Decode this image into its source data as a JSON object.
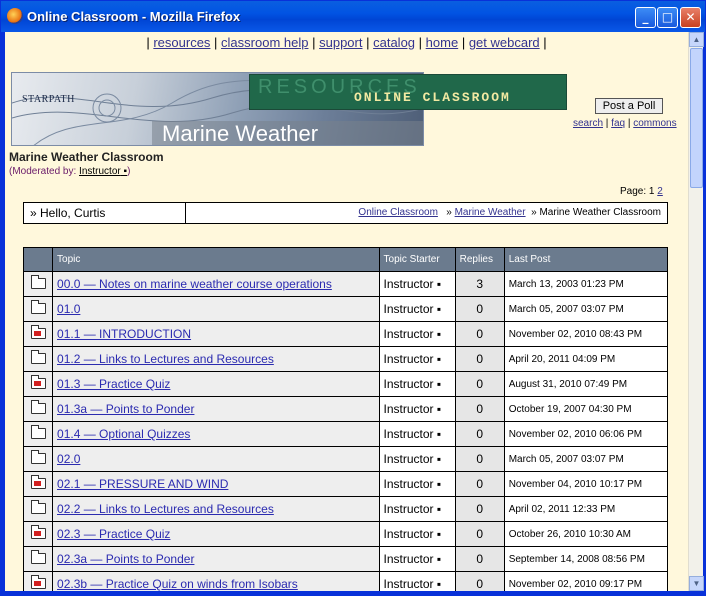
{
  "window": {
    "title": "Online Classroom - Mozilla Firefox"
  },
  "nav": {
    "links": [
      "resources",
      "classroom help",
      "support",
      "catalog",
      "home",
      "get webcard"
    ]
  },
  "banner": {
    "brand": "STARPATH",
    "resources_text": "RESOURCES",
    "online_classroom_text": "ONLINE CLASSROOM",
    "main_title": "Marine Weather"
  },
  "actions": {
    "post_poll": "Post a Poll",
    "search": "search",
    "faq": "faq",
    "commons": "commons"
  },
  "forum": {
    "title": "Marine Weather Classroom",
    "moderated_label": "(Moderated by:",
    "moderator": "Instructor",
    "page_label": "Page: 1",
    "page_next": "2"
  },
  "crumbs": {
    "hello": "Hello, Curtis",
    "online_classroom": "Online Classroom",
    "marine_weather": "Marine Weather",
    "current": "Marine Weather Classroom"
  },
  "table": {
    "headers": {
      "topic": "Topic",
      "starter": "Topic Starter",
      "replies": "Replies",
      "last_post": "Last Post"
    },
    "rows": [
      {
        "icon": "folder-icon",
        "hot": false,
        "topic": "00.0 — Notes on marine weather course operations",
        "starter": "Instructor",
        "replies": "3",
        "last_post": "March 13, 2003 01:23 PM"
      },
      {
        "icon": "folder-icon",
        "hot": false,
        "topic": "01.0",
        "starter": "Instructor",
        "replies": "0",
        "last_post": "March 05, 2007 03:07 PM"
      },
      {
        "icon": "folder-icon",
        "hot": true,
        "topic": "01.1 — INTRODUCTION",
        "starter": "Instructor",
        "replies": "0",
        "last_post": "November 02, 2010 08:43 PM"
      },
      {
        "icon": "folder-icon",
        "hot": false,
        "topic": "01.2 — Links to Lectures and Resources",
        "starter": "Instructor",
        "replies": "0",
        "last_post": "April 20, 2011 04:09 PM"
      },
      {
        "icon": "folder-icon",
        "hot": true,
        "topic": "01.3 — Practice Quiz",
        "starter": "Instructor",
        "replies": "0",
        "last_post": "August 31, 2010 07:49 PM"
      },
      {
        "icon": "folder-icon",
        "hot": false,
        "topic": "01.3a — Points to Ponder",
        "starter": "Instructor",
        "replies": "0",
        "last_post": "October 19, 2007 04:30 PM"
      },
      {
        "icon": "folder-icon",
        "hot": false,
        "topic": "01.4 — Optional Quizzes",
        "starter": "Instructor",
        "replies": "0",
        "last_post": "November 02, 2010 06:06 PM"
      },
      {
        "icon": "folder-icon",
        "hot": false,
        "topic": "02.0",
        "starter": "Instructor",
        "replies": "0",
        "last_post": "March 05, 2007 03:07 PM"
      },
      {
        "icon": "folder-icon",
        "hot": true,
        "topic": "02.1 — PRESSURE AND WIND",
        "starter": "Instructor",
        "replies": "0",
        "last_post": "November 04, 2010 10:17 PM"
      },
      {
        "icon": "folder-icon",
        "hot": false,
        "topic": "02.2 — Links to Lectures and Resources",
        "starter": "Instructor",
        "replies": "0",
        "last_post": "April 02, 2011 12:33 PM"
      },
      {
        "icon": "folder-icon",
        "hot": true,
        "topic": "02.3 — Practice Quiz",
        "starter": "Instructor",
        "replies": "0",
        "last_post": "October 26, 2010 10:30 AM"
      },
      {
        "icon": "folder-icon",
        "hot": false,
        "topic": "02.3a — Points to Ponder",
        "starter": "Instructor",
        "replies": "0",
        "last_post": "September 14, 2008 08:56 PM"
      },
      {
        "icon": "folder-icon",
        "hot": true,
        "topic": "02.3b — Practice Quiz on winds from Isobars",
        "starter": "Instructor",
        "replies": "0",
        "last_post": "November 02, 2010 09:17 PM"
      }
    ]
  },
  "colors": {
    "page_bg": "#fff8dc",
    "header_bg": "#6b7b8e",
    "link": "#33338f",
    "titlebar": "#0153e3"
  }
}
